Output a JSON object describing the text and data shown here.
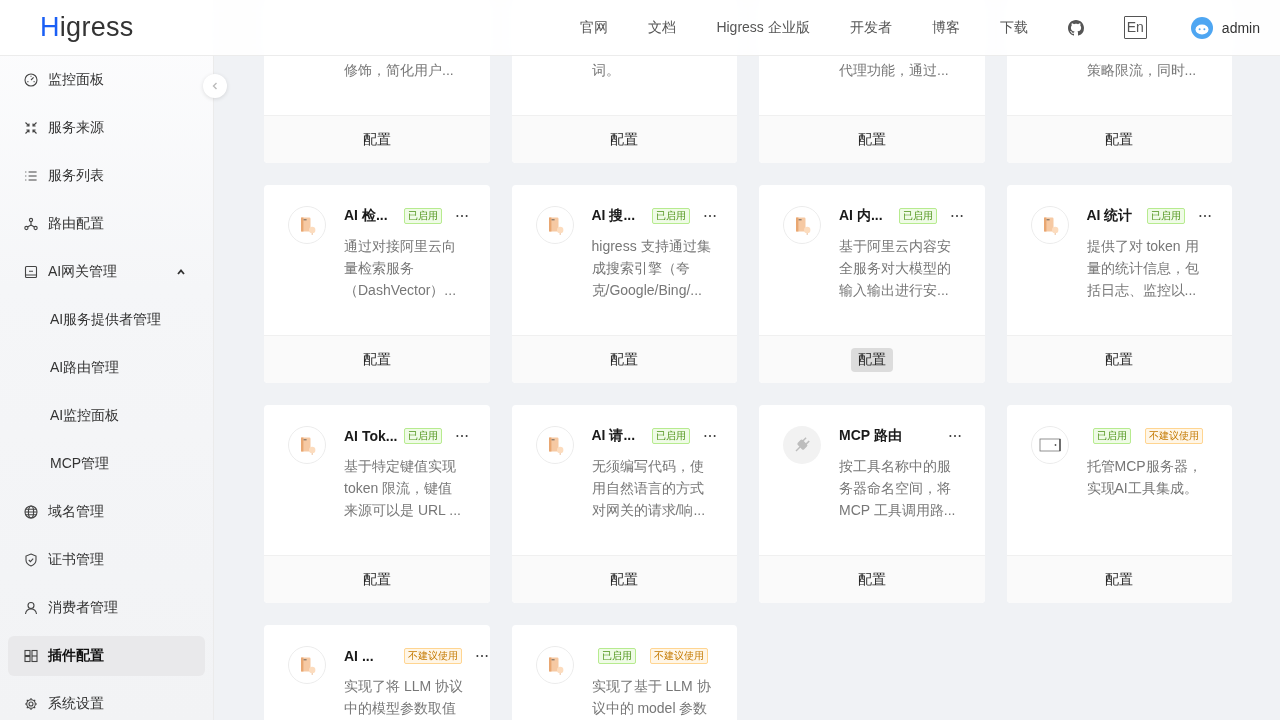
{
  "header": {
    "logo": "Higress",
    "nav": [
      "官网",
      "文档",
      "Higress 企业版",
      "开发者",
      "博客",
      "下载"
    ],
    "language": "En",
    "user": "admin"
  },
  "sidebar": {
    "items": [
      {
        "label": "监控面板",
        "selected": false
      },
      {
        "label": "服务来源",
        "selected": false
      },
      {
        "label": "服务列表",
        "selected": false
      },
      {
        "label": "路由配置",
        "selected": false
      },
      {
        "label": "AI网关管理",
        "selected": false,
        "expanded": true,
        "children": [
          {
            "label": "AI服务提供者管理",
            "selected": false
          },
          {
            "label": "AI路由管理",
            "selected": false
          },
          {
            "label": "AI监控面板",
            "selected": false
          },
          {
            "label": "MCP管理",
            "selected": false
          }
        ]
      },
      {
        "label": "域名管理",
        "selected": false
      },
      {
        "label": "证书管理",
        "selected": false
      },
      {
        "label": "消费者管理",
        "selected": false
      },
      {
        "label": "插件配置",
        "selected": true
      },
      {
        "label": "系统设置",
        "selected": false
      }
    ]
  },
  "plugins": [
    {
      "kind": "partial",
      "description": "修饰，简化用户...",
      "button": "配置",
      "button_hovered": false
    },
    {
      "kind": "partial",
      "description": "词。",
      "button": "配置",
      "button_hovered": false
    },
    {
      "kind": "partial",
      "description": "代理功能，通过...",
      "button": "配置",
      "button_hovered": false
    },
    {
      "kind": "partial",
      "description": "策略限流，同时...",
      "button": "配置",
      "button_hovered": false
    },
    {
      "kind": "plugin",
      "title": "AI 检...",
      "tags": [
        {
          "label": "已启用",
          "color": "#b7eb8f"
        }
      ],
      "has_menu": true,
      "description": "通过对接阿里云向量检索服务（DashVector）...",
      "button": "配置",
      "button_hovered": false
    },
    {
      "kind": "plugin",
      "title": "AI 搜...",
      "tags": [
        {
          "label": "已启用",
          "color": "#b7eb8f"
        }
      ],
      "has_menu": true,
      "description": "higress 支持通过集成搜索引擎（夸克/Google/Bing/...",
      "button": "配置",
      "button_hovered": false
    },
    {
      "kind": "plugin",
      "title": "AI 内...",
      "tags": [
        {
          "label": "已启用",
          "color": "#b7eb8f"
        }
      ],
      "has_menu": true,
      "description": "基于阿里云内容安全服务对大模型的输入输出进行安...",
      "button": "配置",
      "button_hovered": true
    },
    {
      "kind": "plugin",
      "title": "AI 统计",
      "tags": [
        {
          "label": "已启用",
          "color": "#b7eb8f"
        }
      ],
      "has_menu": true,
      "description": "提供了对 token 用量的统计信息，包括日志、监控以...",
      "button": "配置",
      "button_hovered": false
    },
    {
      "kind": "plugin",
      "title": "AI Tok...",
      "tags": [
        {
          "label": "已启用",
          "color": "#b7eb8f"
        }
      ],
      "has_menu": true,
      "description": "基于特定键值实现 token 限流，键值来源可以是 URL ...",
      "button": "配置",
      "button_hovered": false
    },
    {
      "kind": "plugin",
      "title": "AI 请...",
      "tags": [
        {
          "label": "已启用",
          "color": "#b7eb8f"
        }
      ],
      "has_menu": true,
      "description": "无须编写代码，使用自然语言的方式对网关的请求/响...",
      "button": "配置",
      "button_hovered": false
    },
    {
      "kind": "plug",
      "title": "MCP 路由",
      "has_menu": true,
      "description": "按工具名称中的服务器命名空间，将MCP 工具调用路...",
      "button": "配置",
      "button_hovered": false
    },
    {
      "kind": "frame",
      "tags": [
        {
          "label": "已启用",
          "color": "#b7eb8f"
        },
        {
          "label": "不建议使用",
          "color": "#ffd591"
        }
      ],
      "has_menu": false,
      "description": "托管MCP服务器，实现AI工具集成。",
      "button": "配置",
      "button_hovered": false
    },
    {
      "kind": "plugin",
      "title": "AI ...",
      "tags": [
        {
          "label": "不建议使用",
          "color": "#ffd591"
        }
      ],
      "has_menu": true,
      "description": "实现了将 LLM 协议中的模型参数取值"
    },
    {
      "kind": "plugin",
      "tags": [
        {
          "label": "已启用",
          "color": "#b7eb8f"
        },
        {
          "label": "不建议使用",
          "color": "#ffd591"
        }
      ],
      "has_menu": false,
      "description": "实现了基于 LLM 协议中的 model 参数"
    }
  ]
}
